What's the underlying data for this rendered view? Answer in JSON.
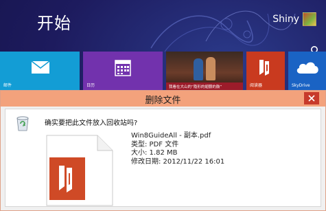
{
  "start_screen": {
    "title": "开始",
    "user_name": "Shiny",
    "tiles": [
      {
        "label": "邮件",
        "color": "#139dd5",
        "icon": "mail-icon"
      },
      {
        "label": "日历",
        "color": "#7232ad",
        "icon": "calendar-icon"
      },
      {
        "label": "",
        "caption": "我看在大山的“隐形的翅膀的鼓”",
        "icon": "photo"
      },
      {
        "label": "阅读器",
        "color": "#c93a1f",
        "icon": "reader-icon"
      },
      {
        "label": "SkyDrive",
        "color": "#1a63c4",
        "icon": "cloud-icon"
      }
    ]
  },
  "dialog": {
    "title": "删除文件",
    "titlebar_color": "#f3a27c",
    "question": "确实要把此文件放入回收站吗?",
    "file": {
      "name": "Win8GuideAll - 副本.pdf",
      "type_line": "类型: PDF 文件",
      "size_line": "大小: 1.82 MB",
      "modified_line": "修改日期: 2012/11/22 16:01"
    }
  }
}
